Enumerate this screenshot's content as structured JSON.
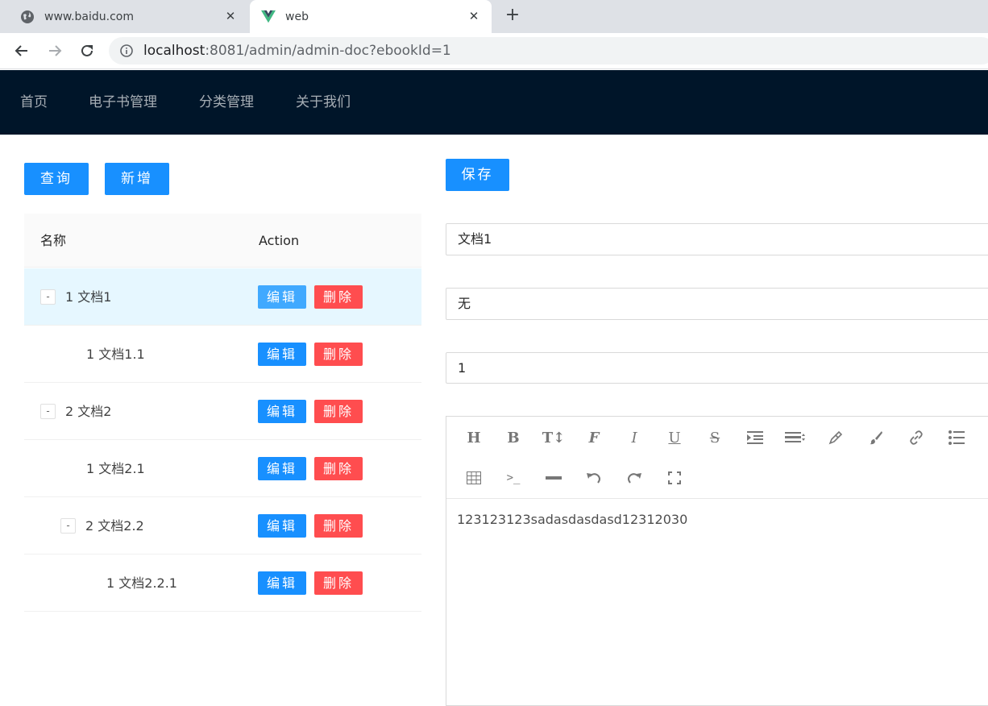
{
  "browser": {
    "tabs": [
      {
        "title": "www.baidu.com",
        "icon": "globe-icon"
      },
      {
        "title": "web",
        "icon": "vue-logo-icon"
      }
    ],
    "url_host": "localhost",
    "url_rest": ":8081/admin/admin-doc?ebookId=1"
  },
  "menu": {
    "items": [
      "首页",
      "电子书管理",
      "分类管理",
      "关于我们"
    ]
  },
  "actions": {
    "query": "查询",
    "add": "新增",
    "save": "保存"
  },
  "table": {
    "columns": [
      "名称",
      "Action"
    ],
    "rows": [
      {
        "name": "1 文档1",
        "level": 0,
        "expandable": true,
        "selected": true
      },
      {
        "name": "1 文档1.1",
        "level": 1,
        "expandable": false,
        "selected": false
      },
      {
        "name": "2 文档2",
        "level": 0,
        "expandable": true,
        "selected": false
      },
      {
        "name": "1 文档2.1",
        "level": 1,
        "expandable": false,
        "selected": false
      },
      {
        "name": "2 文档2.2",
        "level": 1,
        "expandable": true,
        "selected": false
      },
      {
        "name": "1 文档2.2.1",
        "level": 2,
        "expandable": false,
        "selected": false
      }
    ],
    "expander_symbol": "-",
    "edit_label": "编辑",
    "delete_label": "删除"
  },
  "form": {
    "name_value": "文档1",
    "parent_value": "无",
    "sort_value": "1"
  },
  "editor": {
    "toolbar_icons": [
      "heading-icon",
      "bold-icon",
      "font-size-icon",
      "font-family-icon",
      "italic-icon",
      "underline-icon",
      "strikethrough-icon",
      "indent-icon",
      "line-height-icon",
      "font-color-icon",
      "background-color-icon",
      "link-icon",
      "list-icon",
      "table-icon",
      "code-icon",
      "divider-icon",
      "undo-icon",
      "redo-icon",
      "fullscreen-icon"
    ],
    "content": "123123123sadasdasdasd12312030"
  },
  "colors": {
    "header_bg": "#001529",
    "primary": "#1890ff",
    "danger": "#ff4d4f",
    "selected_row": "#e6f7ff"
  }
}
